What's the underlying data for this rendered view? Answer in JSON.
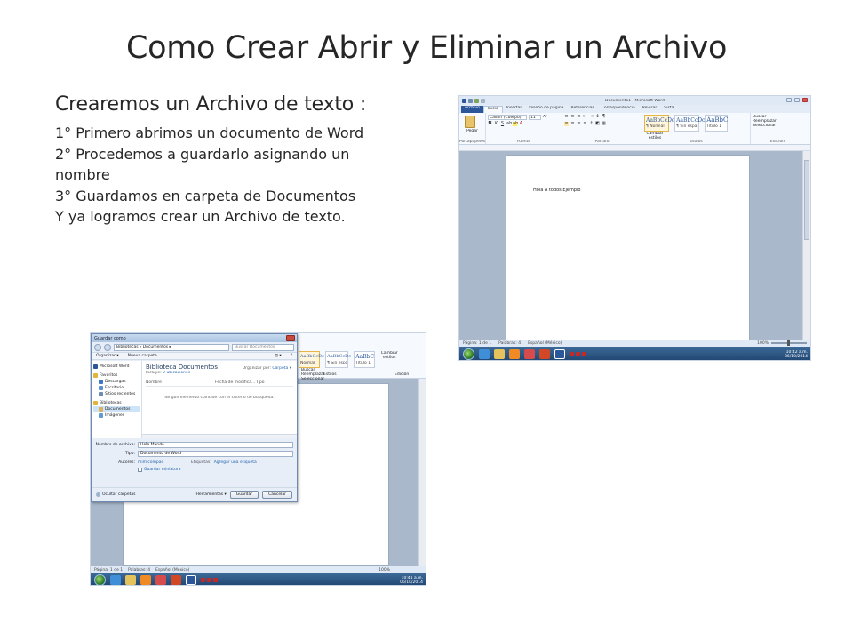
{
  "slide": {
    "title": "Como Crear Abrir y Eliminar un Archivo",
    "subtitle": "Crearemos un Archivo de texto :",
    "steps": [
      "1° Primero abrimos un documento de Word",
      "2° Procedemos a guardarlo asignando un",
      "nombre",
      "3° Guardamos en carpeta de Documentos",
      "Y ya logramos crear un Archivo de texto."
    ]
  },
  "word_window": {
    "title": "Documento1 - Microsoft Word",
    "tabs": [
      "Archivo",
      "Inicio",
      "Insertar",
      "Diseño de página",
      "Referencias",
      "Correspondencia",
      "Revisar",
      "Vista"
    ],
    "font_name": "Calibri (Cuerpo)",
    "font_size": "11",
    "paste_label": "Pegar",
    "groups": [
      "Portapapeles",
      "Fuente",
      "Párrafo",
      "Estilos",
      "Edición"
    ],
    "styles": [
      {
        "sample": "AaBbCcDc",
        "name": "¶ Normal"
      },
      {
        "sample": "AaBbCcDc",
        "name": "¶ Sin espa..."
      },
      {
        "sample": "AaBbC",
        "name": "Título 1"
      }
    ],
    "change_styles": "Cambiar estilos",
    "edit_items": [
      "Buscar",
      "Reemplazar",
      "Seleccionar"
    ],
    "document_text": "Hola A todos Ejemplo",
    "status": {
      "page": "Página: 1 de 1",
      "words": "Palabras: 4",
      "language": "Español (México)",
      "zoom": "100%"
    }
  },
  "taskbar_right": {
    "time": "10:42 a.m.",
    "date": "06/10/2014"
  },
  "taskbar_left": {
    "time": "10:41 a.m.",
    "date": "06/10/2014"
  },
  "save_dialog": {
    "title": "Guardar como",
    "address": "Bibliotecas ▸ Documentos ▸",
    "search_placeholder": "Buscar Documentos",
    "organize": "Organizar ▾",
    "new_folder": "Nueva carpeta",
    "nav_items": [
      {
        "label": "Microsoft Word",
        "color": "#2b579a",
        "sub": false
      },
      {
        "label": "Favoritos",
        "color": "#e2b43a",
        "sub": false
      },
      {
        "label": "Descargas",
        "color": "#3b78c4",
        "sub": true
      },
      {
        "label": "Escritorio",
        "color": "#5a8fd0",
        "sub": true
      },
      {
        "label": "Sitios recientes",
        "color": "#6c8db2",
        "sub": true
      },
      {
        "label": "Bibliotecas",
        "color": "#e2b43a",
        "sub": false
      },
      {
        "label": "Documentos",
        "color": "#d9b35b",
        "sub": true
      },
      {
        "label": "Imágenes",
        "color": "#5b9bd6",
        "sub": true
      }
    ],
    "library_title": "Biblioteca Documentos",
    "includes_prefix": "Incluye:",
    "includes_value": "2 ubicaciones",
    "organize_by_label": "Organizar por:",
    "organize_by_value": "Carpeta ▾",
    "columns": [
      "Nombre",
      "Fecha de modifica...",
      "Tipo"
    ],
    "empty_message": "Ningún elemento coincide con el criterio de búsqueda.",
    "filename_label": "Nombre de archivo:",
    "filename_value": "Hola Mundo",
    "type_label": "Tipo:",
    "type_value": "Documento de Word",
    "authors_label": "Autores:",
    "authors_value": "mimicompac",
    "tags_label": "Etiquetas:",
    "tags_value": "Agregar una etiqueta",
    "thumbnail_label": "Guardar miniatura",
    "hide_folders": "Ocultar carpetas",
    "tools": "Herramientas ▾",
    "save_button": "Guardar",
    "cancel_button": "Cancelar"
  },
  "word_window_2": {
    "styles": [
      {
        "sample": "AaBbCcDc",
        "name": "Normal"
      },
      {
        "sample": "AaBbCcDc",
        "name": "¶ Sin espa..."
      },
      {
        "sample": "AaBbC",
        "name": "Título 1"
      }
    ],
    "change_styles": "Cambiar estilos",
    "edit_items": [
      "Buscar",
      "Reemplazar",
      "Seleccionar"
    ],
    "groups": [
      "Estilos",
      "Edición"
    ],
    "status": {
      "page": "Página: 1 de 1",
      "words": "Palabras: 4",
      "language": "Español (México)",
      "zoom": "100%"
    }
  },
  "colors": {
    "word_blue": "#2b579a",
    "taskbar": "#1f4470"
  }
}
